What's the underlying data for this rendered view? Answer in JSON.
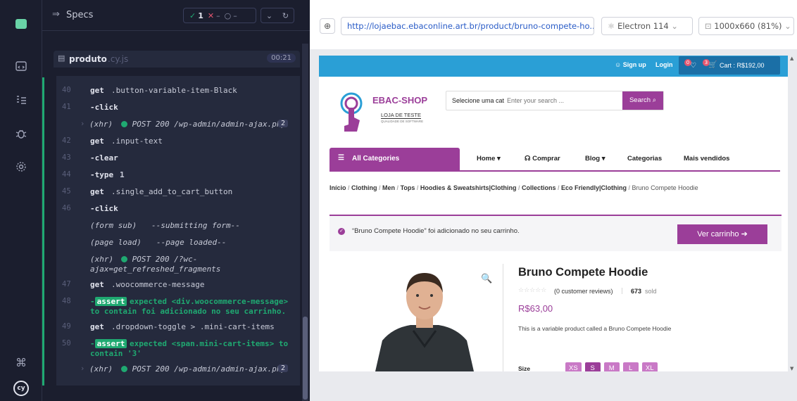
{
  "specs": {
    "header_label": "Specs",
    "passed": "1",
    "failed": "–",
    "pending": "–",
    "file_name": "produto",
    "file_ext": ".cy.js",
    "duration": "00:21"
  },
  "commands": [
    {
      "n": "40",
      "name": "get",
      "text": ".button-variable-item-Black"
    },
    {
      "n": "41",
      "name": "-click",
      "text": ""
    },
    {
      "n": "",
      "name": "(xhr)",
      "text": "POST 200 /wp-admin/admin-ajax.php",
      "count": "2"
    },
    {
      "n": "42",
      "name": "get",
      "text": ".input-text"
    },
    {
      "n": "43",
      "name": "-clear",
      "text": ""
    },
    {
      "n": "44",
      "name": "-type",
      "text": "1"
    },
    {
      "n": "45",
      "name": "get",
      "text": ".single_add_to_cart_button"
    },
    {
      "n": "46",
      "name": "-click",
      "text": ""
    },
    {
      "n": "",
      "name": "(form sub)",
      "text": "--submitting form--"
    },
    {
      "n": "",
      "name": "(page load)",
      "text": "--page loaded--"
    },
    {
      "n": "",
      "name": "(xhr)",
      "text": "POST 200 /?wc-",
      "text2": "ajax=get_refreshed_fragments"
    },
    {
      "n": "47",
      "name": "get",
      "text": ".woocommerce-message"
    },
    {
      "n": "48",
      "name": "-assert",
      "text": "expected <div.woocommerce-message>",
      "text2": "to contain foi adicionado no seu carrinho."
    },
    {
      "n": "49",
      "name": "get",
      "text": ".dropdown-toggle > .mini-cart-items"
    },
    {
      "n": "50",
      "name": "-assert",
      "text": "expected <span.mini-cart-items> to",
      "text2": "contain '3'"
    },
    {
      "n": "",
      "name": "(xhr)",
      "text": "POST 200 /wp-admin/admin-ajax.php",
      "count": "2"
    }
  ],
  "browser": {
    "url": "http://lojaebac.ebaconline.art.br/product/bruno-compete-ho...",
    "browser_name": "Electron 114",
    "viewport": "1000x660 (81%)"
  },
  "shop": {
    "signup": "Sign up",
    "login": "Login",
    "wishlist_count": "0",
    "cart_count": "3",
    "cart_label": "Cart : R$192,00",
    "logo_title": "EBAC-SHOP",
    "logo_sub": "LOJA DE TESTE",
    "logo_tag": "QUALIDADE DE SOFTWARE",
    "category_select": "Selecione uma cat",
    "search_placeholder": "Enter your search ...",
    "search_button": "Search",
    "all_categories": "All Categories",
    "nav": [
      "Home",
      "Comprar",
      "Blog",
      "Categorias",
      "Mais vendidos"
    ],
    "breadcrumb": [
      "Início",
      "Clothing",
      "Men",
      "Tops",
      "Hoodies & Sweatshirts|Clothing",
      "Collections",
      "Eco Friendly|Clothing",
      "Bruno Compete Hoodie"
    ],
    "message": "“Bruno Compete Hoodie” foi adicionado no seu carrinho.",
    "view_cart": "Ver carrinho",
    "product_title": "Bruno Compete Hoodie",
    "reviews": "(0 customer reviews)",
    "sold_count": "673",
    "sold_label": "sold",
    "price": "R$63,00",
    "description": "This is a variable product called a Bruno Compete Hoodie",
    "size_label": "Size",
    "sizes": [
      "XS",
      "S",
      "M",
      "L",
      "XL"
    ]
  },
  "colors": {
    "accent_purple": "#9b3e99",
    "header_blue": "#2a9fd6",
    "cypress_green": "#1fa971"
  }
}
